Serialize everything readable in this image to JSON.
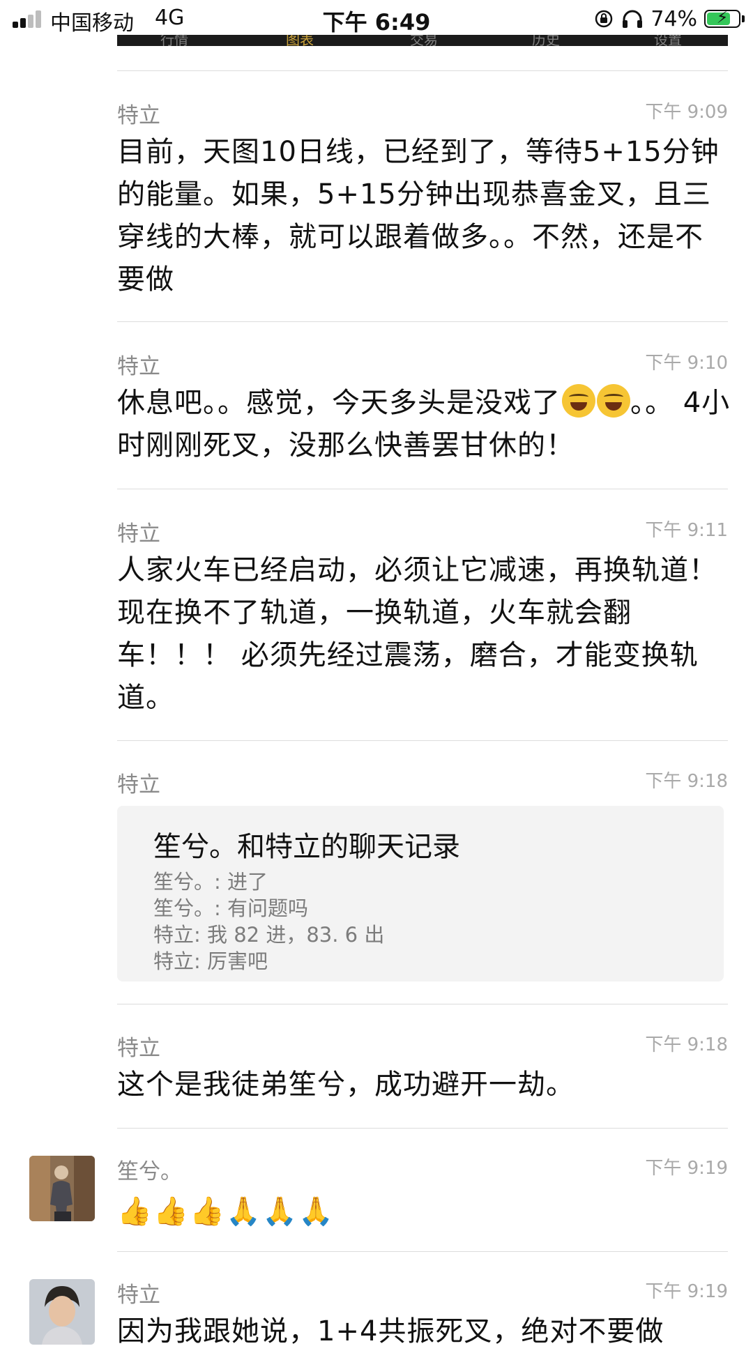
{
  "status_bar": {
    "carrier": "中国移动",
    "network": "4G",
    "time": "下午 6:49",
    "battery": "74%",
    "battery_level": 0.74
  },
  "tab_strip": {
    "tabs": [
      "行情",
      "图表",
      "交易",
      "历史",
      "设置"
    ],
    "active_tab": "图表"
  },
  "messages": [
    {
      "sender": "特立",
      "time": "下午 9:09",
      "text": "目前，天图10日线，已经到了，等待5+15分钟的能量。如果，5+15分钟出现恭喜金叉，且三穿线的大棒，就可以跟着做多。。不然，还是不要做"
    },
    {
      "sender": "特立",
      "time": "下午 9:10",
      "text_before_emoji": "休息吧。。感觉，今天多头是没戏了",
      "emoji": "face-with-tears-of-joy",
      "text_after_emoji": "。。 4小时刚刚死叉，没那么快善罢甘休的！"
    },
    {
      "sender": "特立",
      "time": "下午 9:11",
      "text": "人家火车已经启动，必须让它减速，再换轨道！现在换不了轨道，一换轨道，火车就会翻车！！！ 必须先经过震荡，磨合，才能变换轨道。"
    },
    {
      "sender": "特立",
      "time": "下午 9:18",
      "record": {
        "title": "笙兮。和特立的聊天记录",
        "lines": [
          "笙兮。: 进了",
          "笙兮。: 有问题吗",
          "特立: 我 82 进，83. 6 出",
          "特立: 厉害吧"
        ]
      }
    },
    {
      "sender": "特立",
      "time": "下午 9:18",
      "text": "这个是我徒弟笙兮，成功避开一劫。"
    },
    {
      "sender": "笙兮。",
      "time": "下午 9:19",
      "reactions": [
        "thumbs-up",
        "thumbs-up",
        "thumbs-up",
        "folded-hands",
        "folded-hands",
        "folded-hands"
      ]
    },
    {
      "sender": "特立",
      "time": "下午 9:19",
      "text": "因为我跟她说，1+4共振死叉，绝对不要做"
    }
  ],
  "colors": {
    "text": "#111111",
    "meta": "#8a8a8a",
    "separator": "#dcdcdc",
    "record_bg": "#f3f3f3",
    "tab_bg": "#1b1b1b",
    "tab_active": "#c9a13a",
    "battery_green": "#34c759"
  }
}
